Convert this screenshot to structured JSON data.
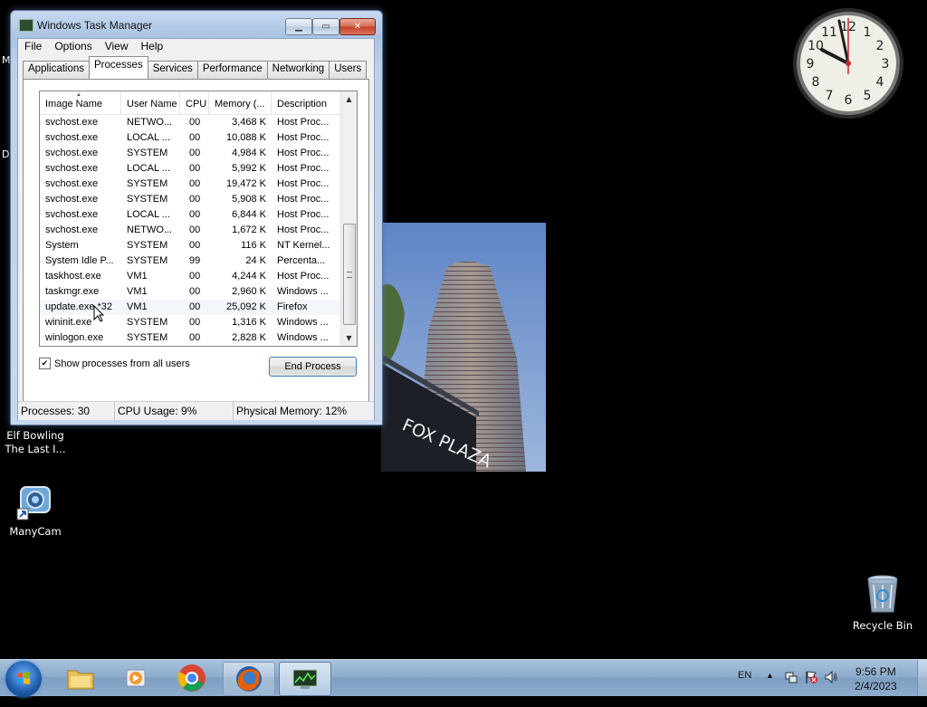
{
  "desktop": {
    "edge_letters": [
      "M",
      "D"
    ],
    "icons": [
      {
        "label": "Elf Bowling The Last I..."
      },
      {
        "label": "ManyCam"
      },
      {
        "label": "Recycle Bin"
      }
    ],
    "photo_caption": "FOX PLAZA",
    "clock_numbers": [
      "12",
      "1",
      "2",
      "3",
      "4",
      "5",
      "6",
      "7",
      "8",
      "9",
      "10",
      "11"
    ]
  },
  "window": {
    "title": "Windows Task Manager",
    "menu": [
      "File",
      "Options",
      "View",
      "Help"
    ],
    "tabs": [
      "Applications",
      "Processes",
      "Services",
      "Performance",
      "Networking",
      "Users"
    ],
    "active_tab": "Processes",
    "columns": [
      "Image Name",
      "User Name",
      "CPU",
      "Memory (...",
      "Description"
    ],
    "rows": [
      [
        "svchost.exe",
        "NETWO...",
        "00",
        "3,468 K",
        "Host Proc..."
      ],
      [
        "svchost.exe",
        "LOCAL ...",
        "00",
        "10,088 K",
        "Host Proc..."
      ],
      [
        "svchost.exe",
        "SYSTEM",
        "00",
        "4,984 K",
        "Host Proc..."
      ],
      [
        "svchost.exe",
        "LOCAL ...",
        "00",
        "5,992 K",
        "Host Proc..."
      ],
      [
        "svchost.exe",
        "SYSTEM",
        "00",
        "19,472 K",
        "Host Proc..."
      ],
      [
        "svchost.exe",
        "SYSTEM",
        "00",
        "5,908 K",
        "Host Proc..."
      ],
      [
        "svchost.exe",
        "LOCAL ...",
        "00",
        "6,844 K",
        "Host Proc..."
      ],
      [
        "svchost.exe",
        "NETWO...",
        "00",
        "1,672 K",
        "Host Proc..."
      ],
      [
        "System",
        "SYSTEM",
        "00",
        "116 K",
        "NT Kernel..."
      ],
      [
        "System Idle P...",
        "SYSTEM",
        "99",
        "24 K",
        "Percenta..."
      ],
      [
        "taskhost.exe",
        "VM1",
        "00",
        "4,244 K",
        "Host Proc..."
      ],
      [
        "taskmgr.exe",
        "VM1",
        "00",
        "2,960 K",
        "Windows ..."
      ],
      [
        "update.exe *32",
        "VM1",
        "00",
        "25,092 K",
        "Firefox"
      ],
      [
        "wininit.exe",
        "SYSTEM",
        "00",
        "1,316 K",
        "Windows ..."
      ],
      [
        "winlogon.exe",
        "SYSTEM",
        "00",
        "2,828 K",
        "Windows ..."
      ]
    ],
    "show_all_label": "Show processes from all users",
    "show_all_checked": true,
    "end_process_label": "End Process",
    "status": {
      "processes": "Processes: 30",
      "cpu": "CPU Usage: 9%",
      "memory": "Physical Memory: 12%"
    }
  },
  "taskbar": {
    "apps": [
      "windows-explorer",
      "media-player",
      "chrome",
      "firefox",
      "task-manager"
    ],
    "language": "EN",
    "time": "9:56 PM",
    "date": "2/4/2023"
  },
  "colors": {
    "desktop_bg": "#000000",
    "window_frame": "#b3c9e6",
    "close_red": "#c4412a",
    "taskbar": "#8eaccd"
  }
}
